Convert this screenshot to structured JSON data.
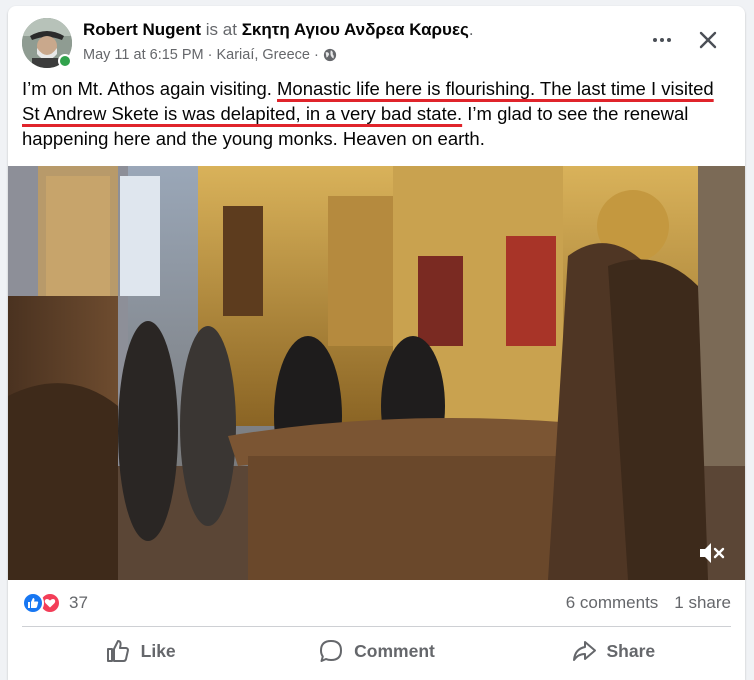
{
  "post": {
    "author": "Robert Nugent",
    "is_at": "is at",
    "place": "Σκητη Αγιου Ανδρεα Καρυες",
    "place_suffix": ".",
    "date": "May 11 at 6:15 PM",
    "separator": "·",
    "location": "Kariaí, Greece",
    "separator2": "·",
    "text": {
      "part1": "I’m on Mt. Athos again visiting.  ",
      "underlined1": "Monastic life here is flourishing. The last time I visited St Andrew Skete is was delapited, in a very bad state.",
      "part2": "  I’m glad to see the renewal happening here and the young monks. Heaven on earth."
    }
  },
  "stats": {
    "reaction_count": "37",
    "comments": "6 comments",
    "shares": "1 share"
  },
  "actions": {
    "like": "Like",
    "comment": "Comment",
    "share": "Share"
  },
  "colors": {
    "brand_blue": "#1877f2",
    "love_red": "#f33e58",
    "annotation_red": "#e0242b",
    "online_green": "#31a24c",
    "secondary_text": "#65676b"
  },
  "icons": {
    "privacy": "globe-icon",
    "more": "more-options-icon",
    "close": "close-icon",
    "video": "mute-icon",
    "like_reaction": "like-reaction-icon",
    "love_reaction": "love-reaction-icon",
    "like_action": "thumbs-up-icon",
    "comment_action": "comment-bubble-icon",
    "share_action": "share-arrow-icon"
  }
}
